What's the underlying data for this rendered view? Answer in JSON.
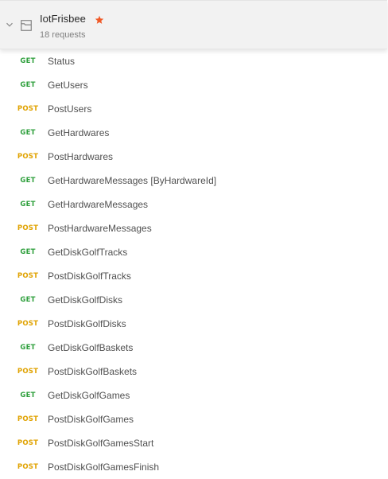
{
  "collection": {
    "name": "IotFrisbee",
    "request_count": "18 requests",
    "starred": true,
    "colors": {
      "star": "#f05a28",
      "get": "#2e9f3c",
      "post": "#e0a200"
    }
  },
  "requests": [
    {
      "method": "GET",
      "name": "Status"
    },
    {
      "method": "GET",
      "name": "GetUsers"
    },
    {
      "method": "POST",
      "name": "PostUsers"
    },
    {
      "method": "GET",
      "name": "GetHardwares"
    },
    {
      "method": "POST",
      "name": "PostHardwares"
    },
    {
      "method": "GET",
      "name": "GetHardwareMessages [ByHardwareId]"
    },
    {
      "method": "GET",
      "name": "GetHardwareMessages"
    },
    {
      "method": "POST",
      "name": "PostHardwareMessages"
    },
    {
      "method": "GET",
      "name": "GetDiskGolfTracks"
    },
    {
      "method": "POST",
      "name": "PostDiskGolfTracks"
    },
    {
      "method": "GET",
      "name": "GetDiskGolfDisks"
    },
    {
      "method": "POST",
      "name": "PostDiskGolfDisks"
    },
    {
      "method": "GET",
      "name": "GetDiskGolfBaskets"
    },
    {
      "method": "POST",
      "name": "PostDiskGolfBaskets"
    },
    {
      "method": "GET",
      "name": "GetDiskGolfGames"
    },
    {
      "method": "POST",
      "name": "PostDiskGolfGames"
    },
    {
      "method": "POST",
      "name": "PostDiskGolfGamesStart"
    },
    {
      "method": "POST",
      "name": "PostDiskGolfGamesFinish"
    }
  ]
}
